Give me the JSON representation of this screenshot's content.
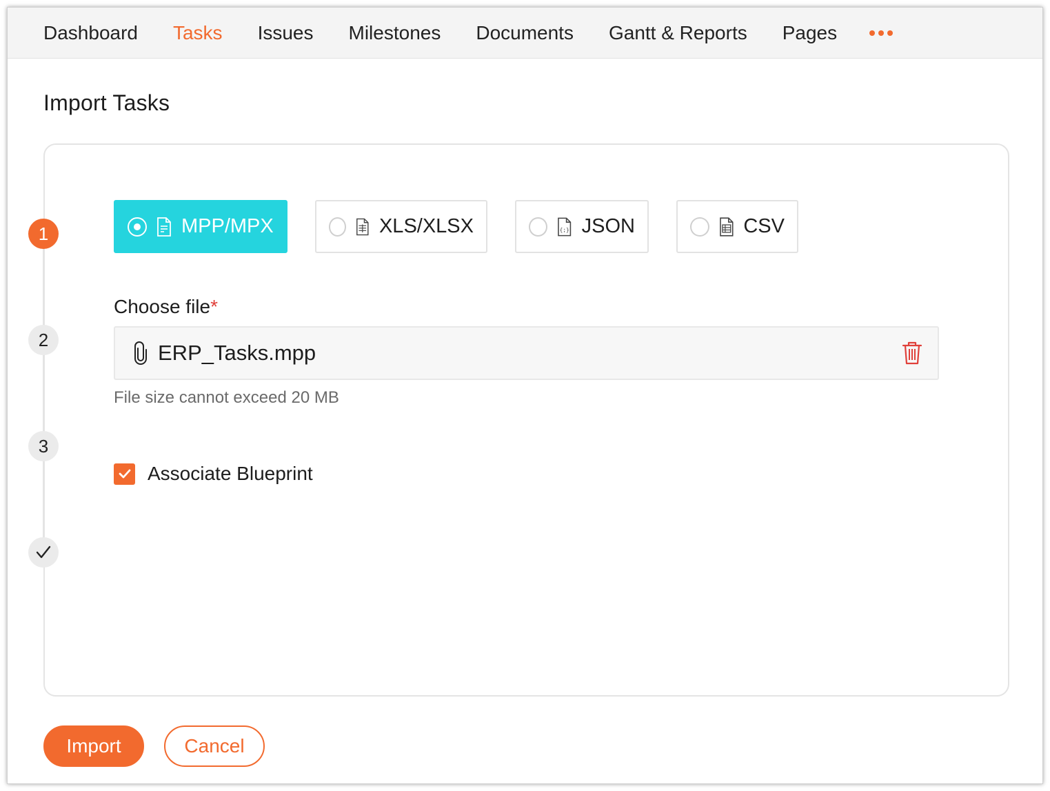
{
  "nav": {
    "items": [
      {
        "label": "Dashboard",
        "active": false
      },
      {
        "label": "Tasks",
        "active": true
      },
      {
        "label": "Issues",
        "active": false
      },
      {
        "label": "Milestones",
        "active": false
      },
      {
        "label": "Documents",
        "active": false
      },
      {
        "label": "Gantt & Reports",
        "active": false
      },
      {
        "label": "Pages",
        "active": false
      }
    ],
    "more_icon": "more-horizontal-icon"
  },
  "page": {
    "title": "Import Tasks"
  },
  "stepper": {
    "steps": [
      "1",
      "2",
      "3"
    ],
    "active_step": 1,
    "final_icon": "checkmark-icon"
  },
  "formats": {
    "options": [
      {
        "label": "MPP/MPX",
        "icon": "document-icon"
      },
      {
        "label": "XLS/XLSX",
        "icon": "spreadsheet-file-icon"
      },
      {
        "label": "JSON",
        "icon": "json-file-icon"
      },
      {
        "label": "CSV",
        "icon": "csv-file-icon"
      }
    ],
    "selected": "MPP/MPX"
  },
  "file": {
    "label": "Choose file",
    "required_mark": "*",
    "value": "ERP_Tasks.mpp",
    "hint": "File size cannot exceed 20 MB",
    "attach_icon": "paperclip-icon",
    "delete_icon": "trash-icon"
  },
  "blueprint": {
    "label": "Associate Blueprint",
    "checked": true
  },
  "actions": {
    "import_label": "Import",
    "cancel_label": "Cancel"
  },
  "colors": {
    "accent": "#f26a2e",
    "selected_format": "#25d4de",
    "delete": "#e0403a"
  }
}
